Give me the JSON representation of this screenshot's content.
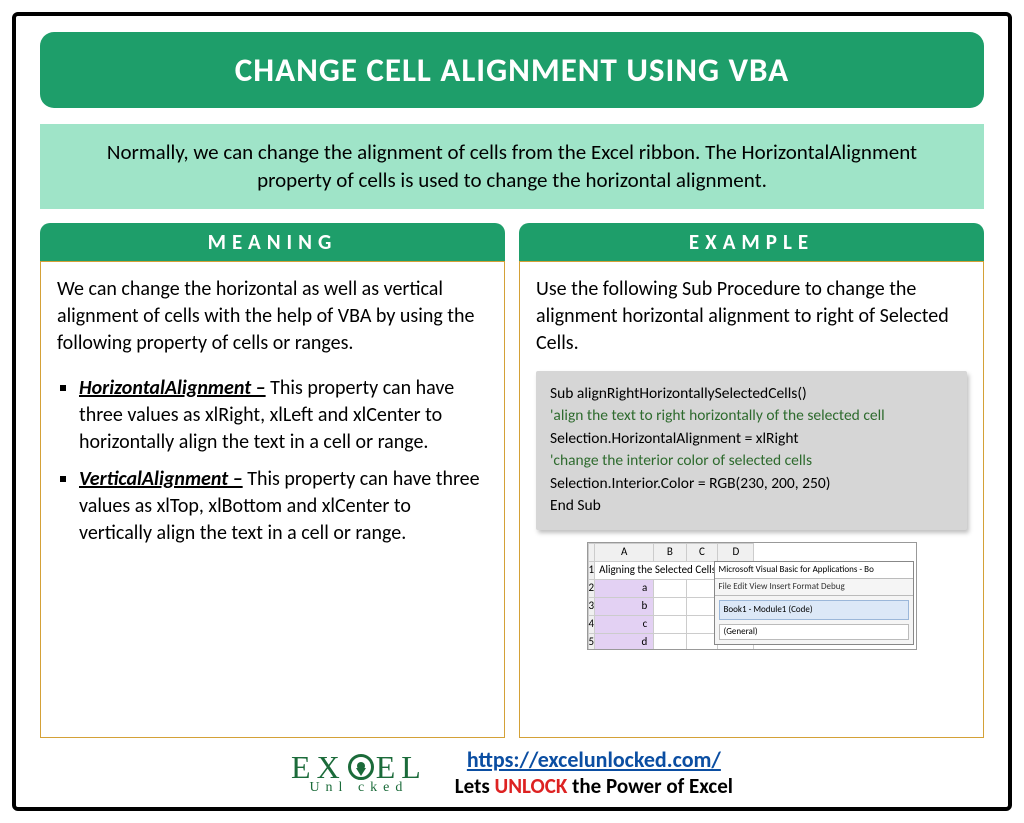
{
  "title": "CHANGE CELL ALIGNMENT USING VBA",
  "intro": "Normally, we can change the alignment of cells from the Excel ribbon. The HorizontalAlignment property of cells is used to change the horizontal alignment.",
  "left": {
    "header": "MEANING",
    "lead": "We can change the horizontal as well as vertical alignment of cells with the help of VBA by using the following property of cells or ranges.",
    "items": [
      {
        "name": "HorizontalAlignment –",
        "desc": " This property can have three values as xlRight, xlLeft and xlCenter to horizontally align the text in a cell or range."
      },
      {
        "name": "VerticalAlignment –",
        "desc": " This property can have three values as xlTop, xlBottom and xlCenter to vertically align the text in a cell or range."
      }
    ]
  },
  "right": {
    "header": "EXAMPLE",
    "lead": "Use the following Sub Procedure to change the alignment horizontal alignment to right of Selected Cells.",
    "code": {
      "l1": "Sub alignRightHorizontallySelectedCells()",
      "l2": "'align the text to right horizontally of the selected cell",
      "l3": "Selection.HorizontalAlignment = xlRight",
      "l4": "'change the interior color of selected cells",
      "l5": "Selection.Interior.Color = RGB(230, 200, 250)",
      "l6": "End Sub"
    },
    "mini": {
      "cols": [
        "A",
        "B",
        "C",
        "D"
      ],
      "row1": "Aligning the Selected Cells to Right",
      "cells": [
        "a",
        "b",
        "c",
        "d"
      ],
      "vbe_title": "Microsoft Visual Basic for Applications - Bo",
      "vbe_menu": "File  Edit  View  Insert  Format  Debug",
      "vbe_mod": "Book1 - Module1 (Code)",
      "vbe_gen": "(General)"
    }
  },
  "footer": {
    "logo_top_left": "EX",
    "logo_top_right": "EL",
    "logo_bot": "Unl   cked",
    "url": "https://excelunlocked.com/",
    "tag_pre": "Lets ",
    "tag_unlock": "UNLOCK",
    "tag_post": " the Power of Excel"
  }
}
